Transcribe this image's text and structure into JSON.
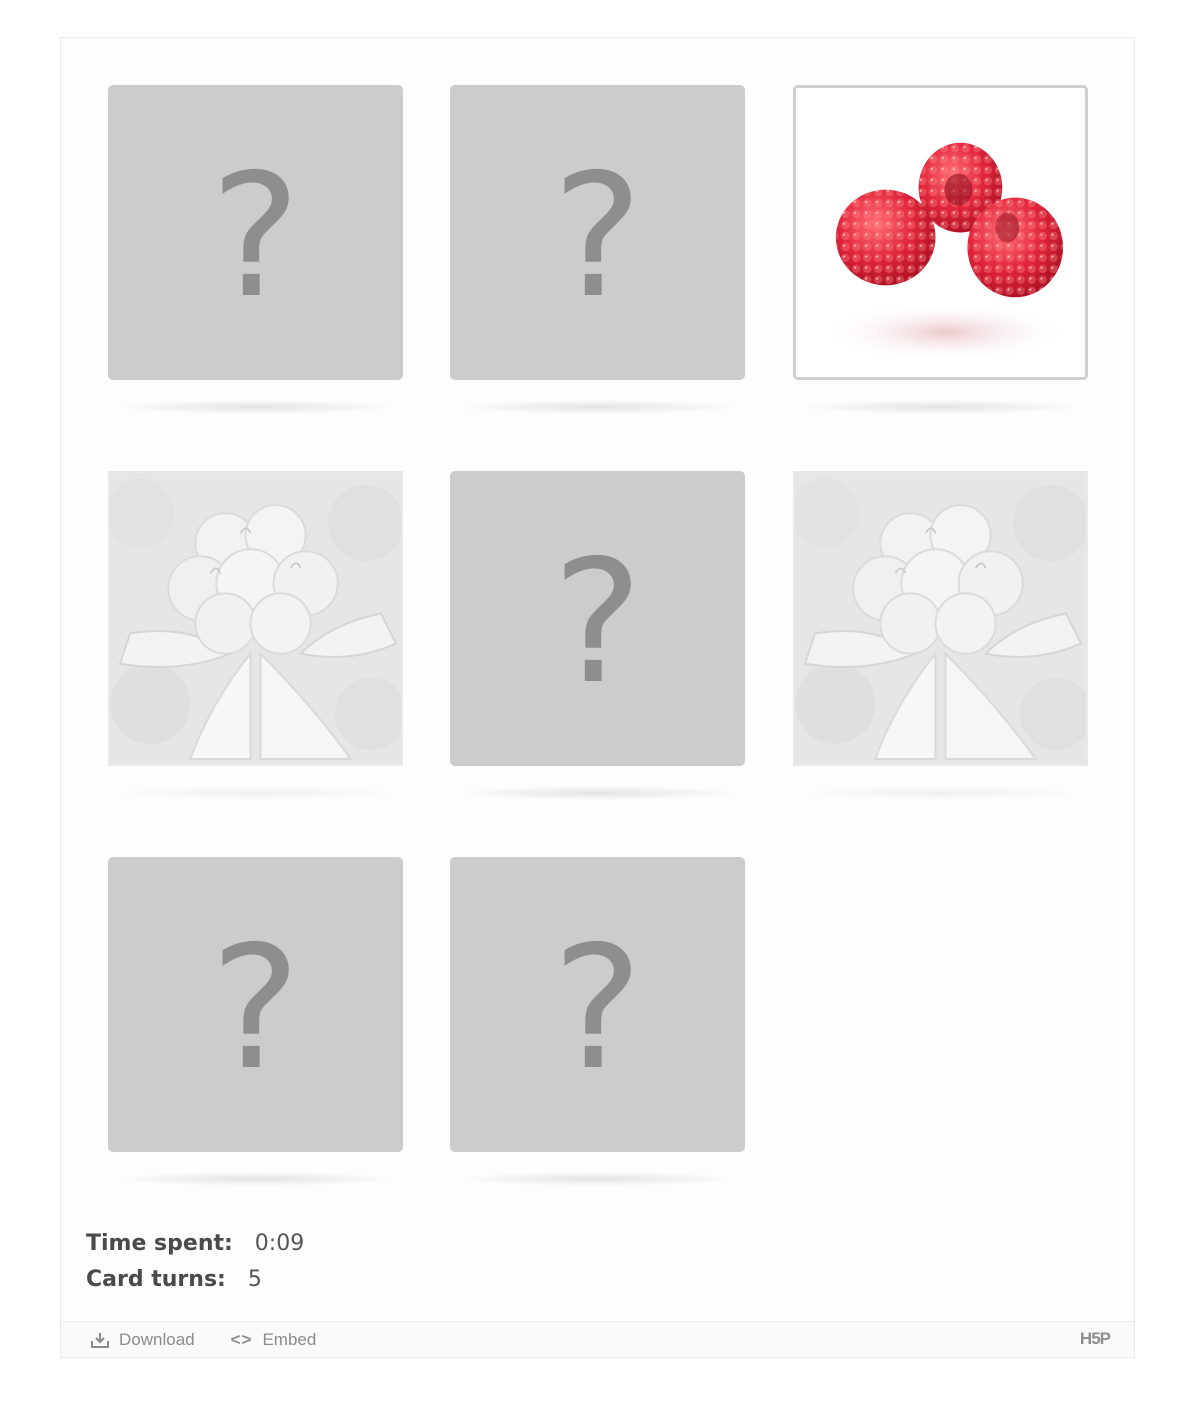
{
  "cards": [
    {
      "state": "face-down",
      "symbol": "?"
    },
    {
      "state": "face-down",
      "symbol": "?"
    },
    {
      "state": "face-up",
      "image": "raspberries"
    },
    {
      "state": "matched",
      "image": "cloudberry"
    },
    {
      "state": "face-down",
      "symbol": "?"
    },
    {
      "state": "matched",
      "image": "cloudberry"
    },
    {
      "state": "face-down",
      "symbol": "?"
    },
    {
      "state": "face-down",
      "symbol": "?"
    }
  ],
  "stats": {
    "time_label": "Time spent:",
    "time_value": "0:09",
    "turns_label": "Card turns:",
    "turns_value": "5"
  },
  "footer": {
    "download_label": "Download",
    "embed_label": "Embed",
    "embed_icon": "<>",
    "logo_text": "H5P"
  },
  "colors": {
    "card_back": "#cccccc",
    "question_mark": "#8e8e8e",
    "raspberry": "#e0243a",
    "text": "#4a4a4a"
  }
}
